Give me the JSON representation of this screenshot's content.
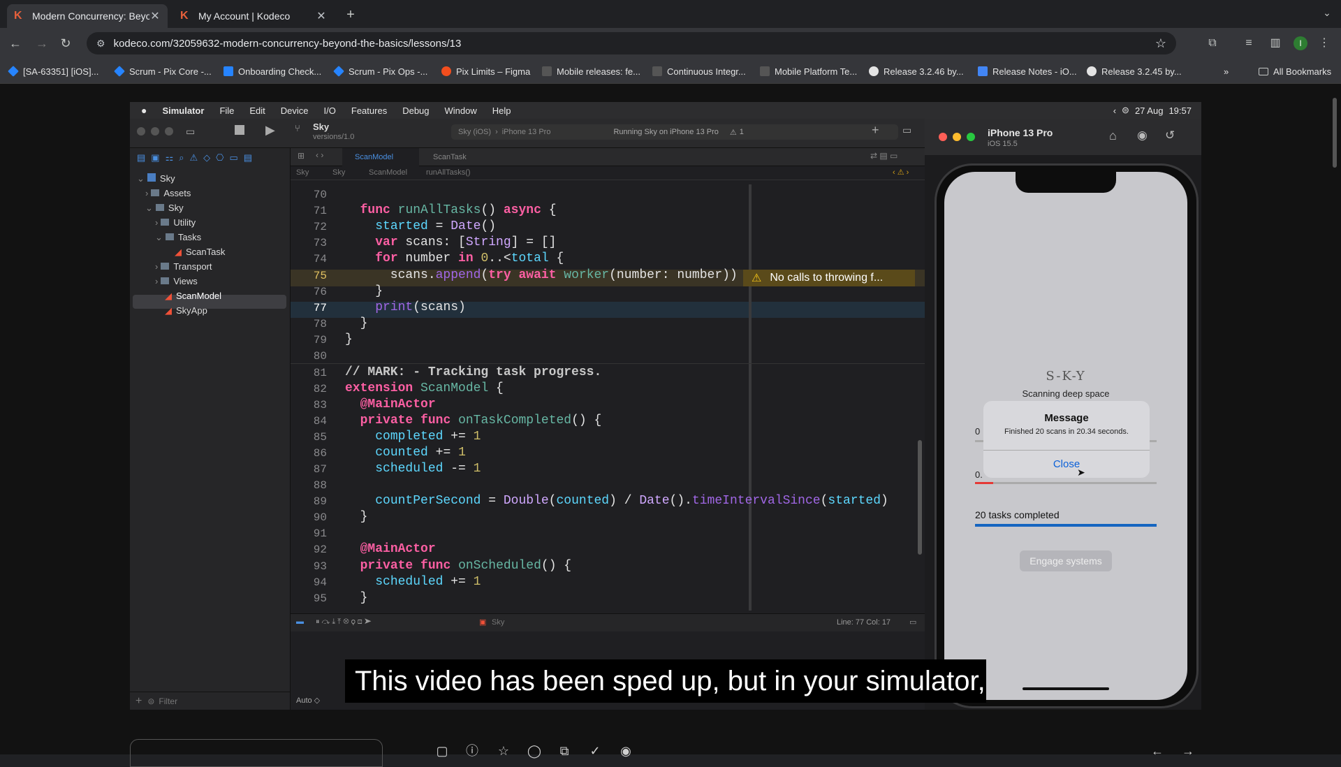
{
  "browser": {
    "tabs": [
      {
        "title": "Modern Concurrency: Beyond",
        "active": true
      },
      {
        "title": "My Account | Kodeco",
        "active": false
      }
    ],
    "url": "kodeco.com/32059632-modern-concurrency-beyond-the-basics/lessons/13",
    "bookmarks": [
      {
        "label": "[SA-63351] [iOS]...",
        "color": "#2684ff"
      },
      {
        "label": "Scrum - Pix Core -...",
        "color": "#2684ff"
      },
      {
        "label": "Onboarding Check...",
        "color": "#2684ff"
      },
      {
        "label": "Scrum - Pix Ops -...",
        "color": "#2684ff"
      },
      {
        "label": "Pix Limits – Figma",
        "color": "#f24e1e"
      },
      {
        "label": "Mobile releases: fe...",
        "color": "#ffffff"
      },
      {
        "label": "Continuous Integr...",
        "color": "#ffffff"
      },
      {
        "label": "Mobile Platform Te...",
        "color": "#ffffff"
      },
      {
        "label": "Release 3.2.46 by...",
        "color": "#ffffff"
      },
      {
        "label": "Release Notes - iO...",
        "color": "#4285f4"
      },
      {
        "label": "Release 3.2.45 by...",
        "color": "#ffffff"
      }
    ],
    "all_bookmarks": "All Bookmarks",
    "profile_initial": "I"
  },
  "mac_menu": {
    "app": "Simulator",
    "items": [
      "File",
      "Edit",
      "Device",
      "I/O",
      "Features",
      "Debug",
      "Window",
      "Help"
    ],
    "date": "27 Aug",
    "time": "19:57"
  },
  "xcode": {
    "project": "Sky",
    "version": "versions/1.0",
    "scheme": "Sky (iOS)",
    "destination": "iPhone 13 Pro",
    "status": "Running Sky on iPhone 13 Pro",
    "warnings": "1",
    "tabs": [
      "ScanModel",
      "ScanTask"
    ],
    "jumpbar": [
      "Sky",
      "Sky",
      "ScanModel",
      "runAllTasks()"
    ],
    "navigator": [
      {
        "label": "Sky",
        "level": 0,
        "kind": "project"
      },
      {
        "label": "Assets",
        "level": 1,
        "kind": "folder"
      },
      {
        "label": "Sky",
        "level": 1,
        "kind": "folder"
      },
      {
        "label": "Utility",
        "level": 2,
        "kind": "folder"
      },
      {
        "label": "Tasks",
        "level": 2,
        "kind": "folder"
      },
      {
        "label": "ScanTask",
        "level": 3,
        "kind": "swift"
      },
      {
        "label": "Transport",
        "level": 2,
        "kind": "folder"
      },
      {
        "label": "Views",
        "level": 2,
        "kind": "folder"
      },
      {
        "label": "ScanModel",
        "level": 2,
        "kind": "swift"
      },
      {
        "label": "SkyApp",
        "level": 2,
        "kind": "swift"
      }
    ],
    "filter_placeholder": "Filter",
    "warning_message": "No calls to throwing f...",
    "cursor": "Line: 77  Col: 17",
    "console_mode": "Auto ◇",
    "bottom_target": "Sky"
  },
  "code_lines": [
    "70",
    "71",
    "72",
    "73",
    "74",
    "75",
    "76",
    "77",
    "78",
    "79",
    "80",
    "81",
    "82",
    "83",
    "84",
    "85",
    "86",
    "87",
    "88",
    "89",
    "90",
    "91",
    "92",
    "93",
    "94",
    "95"
  ],
  "simulator": {
    "device": "iPhone 13 Pro",
    "os": "iOS 15.5",
    "logo": "S-K-Y",
    "subtitle": "Scanning deep space",
    "alert_title": "Message",
    "alert_message": "Finished 20 scans in 20.34 seconds.",
    "alert_button": "Close",
    "tasks_completed": "20 tasks completed",
    "engage_button": "Engage systems",
    "progress_label_1": "0",
    "progress_label_2": "0.",
    "progress_fill_1": 0.1,
    "progress_fill_2": 1.0
  },
  "caption": "This video has been sped up, but in your simulator,"
}
